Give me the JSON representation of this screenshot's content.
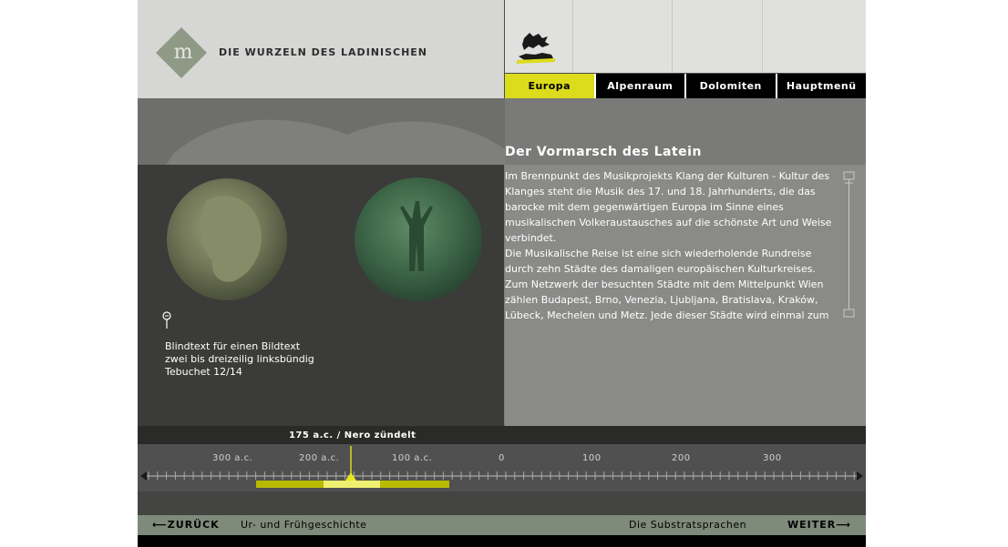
{
  "header": {
    "title": "DIE WURZELN DES LADINISCHEN",
    "logo_letter": "m"
  },
  "nav": {
    "tabs": [
      {
        "label": "Europa",
        "active": true
      },
      {
        "label": "Alpenraum",
        "active": false
      },
      {
        "label": "Dolomiten",
        "active": false
      },
      {
        "label": "Hauptmenü",
        "active": false
      }
    ]
  },
  "caption": {
    "lines": [
      "Blindtext für einen Bildtext",
      "zwei bis dreizeilig linksbündig",
      "Tebuchet 12/14"
    ]
  },
  "article": {
    "title": "Der Vormarsch des Latein",
    "para1": "Im Brennpunkt des Musikprojekts Klang der Kulturen - Kultur des Klanges steht die Musik des 17. und 18. Jahrhunderts, die das barocke mit dem gegenwärtigen Europa im Sinne eines musikalischen Volkeraustausches auf die schönste Art und Weise verbindet.",
    "para2": "Die Musikalische Reise ist eine sich wiederholende Rundreise durch zehn Städte des damaligen europäischen Kulturkreises. Zum Netzwerk der besuchten Städte mit dem Mittelpunkt Wien zählen Budapest, Brno, Venezia, Ljubljana, Bratislava, Kraków, Lübeck, Mechelen und Metz. Jede dieser Städte wird einmal zum"
  },
  "timeline": {
    "event_label": "175 a.c. / Nero zündelt",
    "years": [
      "300 a.c.",
      "200 a.c.",
      "100 a.c.",
      "0",
      "100",
      "200",
      "300"
    ],
    "colors": {
      "range": "#b9b900",
      "window": "#f0f070",
      "marker": "#e8e820"
    }
  },
  "footer": {
    "back_label": "ZURÜCK",
    "back_section": "Ur- und Frühgeschichte",
    "next_section": "Die Substratsprachen",
    "next_label": "WEITER"
  },
  "colors": {
    "accent": "#dcdc1c",
    "nav_bg": "#000000",
    "panel_dark": "#3b3b39"
  }
}
